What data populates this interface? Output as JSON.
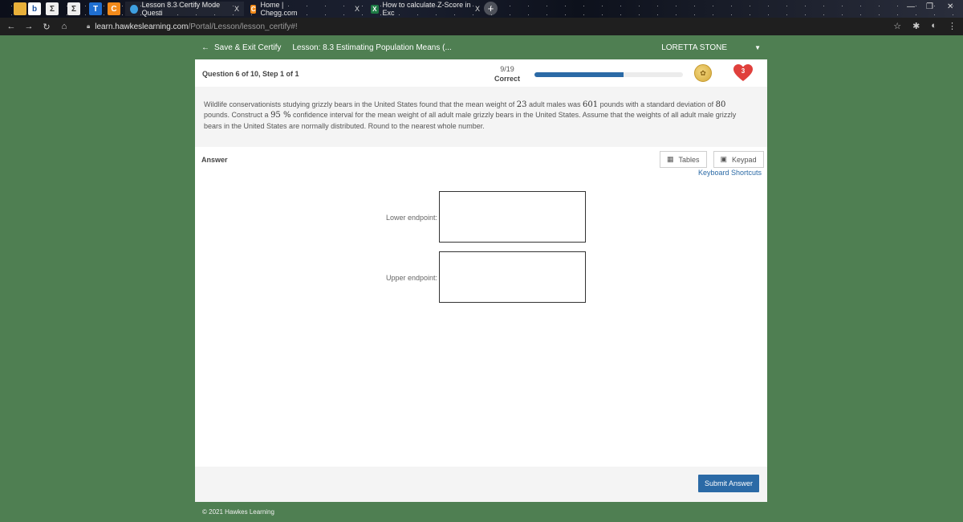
{
  "browser": {
    "mini_tabs": [
      "b",
      "Σ",
      "Σ",
      "T",
      "C"
    ],
    "tabs": [
      {
        "title": "Lesson 8.3 Certify Mode Questi",
        "close": "X",
        "icon": "ball-icon"
      },
      {
        "title": "Home | Chegg.com",
        "close": "X",
        "icon": "C"
      },
      {
        "title": "How to calculate Z-Score in Exc",
        "close": "X",
        "icon": "X"
      }
    ],
    "new_tab": "+",
    "url_host": "learn.hawkeslearning.com",
    "url_path": "/Portal/Lesson/lesson_certify#!",
    "colors": {
      "tab_dark": "#0c0f1a",
      "address_bar": "#1f1f1f"
    }
  },
  "header": {
    "save_exit": "Save & Exit Certify",
    "lesson": "Lesson: 8.3 Estimating Population Means (...",
    "user": "LORETTA STONE",
    "bg_color": "#4f7f52"
  },
  "status": {
    "question_label": "Question 6 of 10, Step 1 of 1",
    "score": "9/19",
    "score_status": "Correct",
    "progress_fraction": 0.6,
    "lives": "3"
  },
  "question": {
    "t1": "Wildlife conservationists studying grizzly bears in the United States found that the mean weight of ",
    "n_sample": "23",
    "t2": " adult males was ",
    "mean": "601",
    "t3": " pounds with a standard deviation of ",
    "sd": "80",
    "t4": " pounds. Construct a ",
    "conf": "95 %",
    "t5": " confidence interval for the mean weight of all adult male grizzly bears in the United States. Assume that the weights of all adult male grizzly bears in the United States are normally distributed. Round to the nearest whole number."
  },
  "answer": {
    "label": "Answer",
    "tables": "Tables",
    "keypad": "Keypad",
    "shortcuts": "Keyboard Shortcuts",
    "lower_label": "Lower endpoint:",
    "upper_label": "Upper endpoint:",
    "lower_value": "",
    "upper_value": ""
  },
  "submit": "Submit Answer",
  "footer": "© 2021 Hawkes Learning"
}
